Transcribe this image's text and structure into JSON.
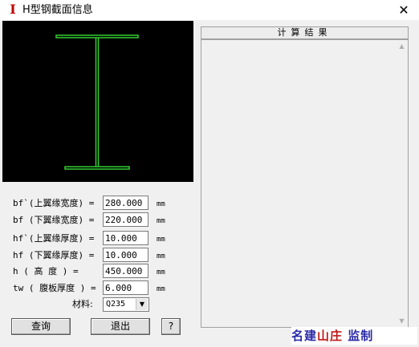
{
  "window": {
    "title": "H型钢截面信息",
    "close_glyph": "✕",
    "icon_glyph": "I"
  },
  "params": [
    {
      "label": "bf`(上翼缘宽度) =",
      "value": "280.000",
      "unit": "mm"
    },
    {
      "label": "bf (下翼缘宽度) =",
      "value": "220.000",
      "unit": "mm"
    },
    {
      "label": "hf`(上翼缘厚度) =",
      "value": "10.000",
      "unit": "mm"
    },
    {
      "label": "hf (下翼缘厚度) =",
      "value": "10.000",
      "unit": "mm"
    },
    {
      "label": "h  ( 高    度 ) =",
      "value": "450.000",
      "unit": "mm"
    },
    {
      "label": "tw ( 腹板厚度 ) =",
      "value": "6.000",
      "unit": "mm"
    }
  ],
  "material": {
    "label": "材料:",
    "value": "Q235"
  },
  "buttons": {
    "query": "查询",
    "exit": "退出",
    "help": "?"
  },
  "results": {
    "header": "计算结果"
  },
  "watermark": {
    "part1": "名建",
    "part2": "山庄",
    "part3": "监制"
  },
  "colors": {
    "section_line": "#33cc33",
    "preview_bg": "#000000",
    "title_icon": "#c00000"
  }
}
